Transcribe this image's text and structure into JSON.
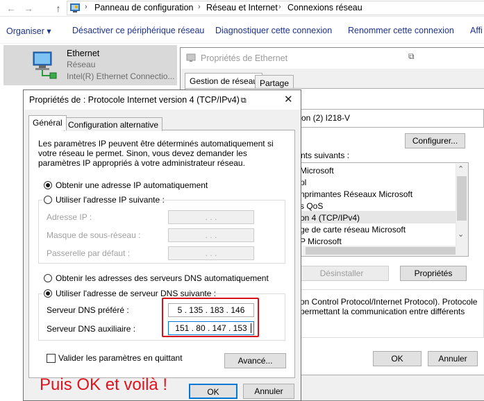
{
  "addressbar": {
    "breadcrumbs": [
      "Panneau de configuration",
      "Réseau et Internet",
      "Connexions réseau"
    ],
    "separator": "›",
    "back_icon": "←",
    "forward_icon": "→",
    "up_icon": "↑"
  },
  "commandbar": {
    "organiser": "Organiser ▾",
    "disable": "Désactiver ce périphérique réseau",
    "diagnose": "Diagnostiquer cette connexion",
    "rename": "Renommer cette connexion",
    "more": "Affi"
  },
  "connection": {
    "name": "Ethernet",
    "network": "Réseau",
    "device": "Intel(R) Ethernet Connectio..."
  },
  "eth_window": {
    "title": "Propriétés de Ethernet",
    "close_glyph": "⧉",
    "tabs": [
      "Gestion de réseau",
      "Partage"
    ],
    "adapter": "on (2) I218-V",
    "configure_button": "Configurer...",
    "components_label": "nts suivants :",
    "components": [
      "Microsoft",
      "pl",
      "nprimantes Réseaux Microsoft",
      "s QoS",
      "on 4 (TCP/IPv4)",
      "ge de carte réseau Microsoft",
      "P Microsoft"
    ],
    "uninstall_button": "Désinstaller",
    "properties_button": "Propriétés",
    "description": "on Control Protocol/Internet Protocol). Protocole permettant la communication entre différents",
    "ok_button": "OK",
    "cancel_button": "Annuler",
    "scroll_up": "⌃",
    "scroll_down": "⌄"
  },
  "ip_window": {
    "title": "Propriétés de : Protocole Internet version 4 (TCP/IPv4)",
    "title_icon": "⧉",
    "close_glyph": "✕",
    "tabs": [
      "Général",
      "Configuration alternative"
    ],
    "intro": "Les paramètres IP peuvent être déterminés automatiquement si votre réseau le permet. Sinon, vous devez demander les paramètres IP appropriés à votre administrateur réseau.",
    "ip_auto": "Obtenir une adresse IP automatiquement",
    "ip_manual": "Utiliser l'adresse IP suivante :",
    "ip_address_label": "Adresse IP :",
    "subnet_label": "Masque de sous-réseau :",
    "gateway_label": "Passerelle par défaut :",
    "empty_ip": ".        .        .",
    "dns_auto": "Obtenir les adresses des serveurs DNS automatiquement",
    "dns_manual": "Utiliser l'adresse de serveur DNS suivante :",
    "dns_pref_label": "Serveur DNS préféré :",
    "dns_alt_label": "Serveur DNS auxiliaire :",
    "dns_pref_value": "5   .  135  .  183  .  146",
    "dns_alt_value": "151  .   80  .  147  .  153",
    "validate_label": "Valider les paramètres en quittant",
    "advanced_button": "Avancé...",
    "ok_button": "OK",
    "cancel_button": "Annuler"
  },
  "annotation": "Puis OK et voilà !",
  "colors": {
    "annotation": "#e0141e",
    "highlight_box": "#d7101a",
    "focus": "#0078d7"
  }
}
